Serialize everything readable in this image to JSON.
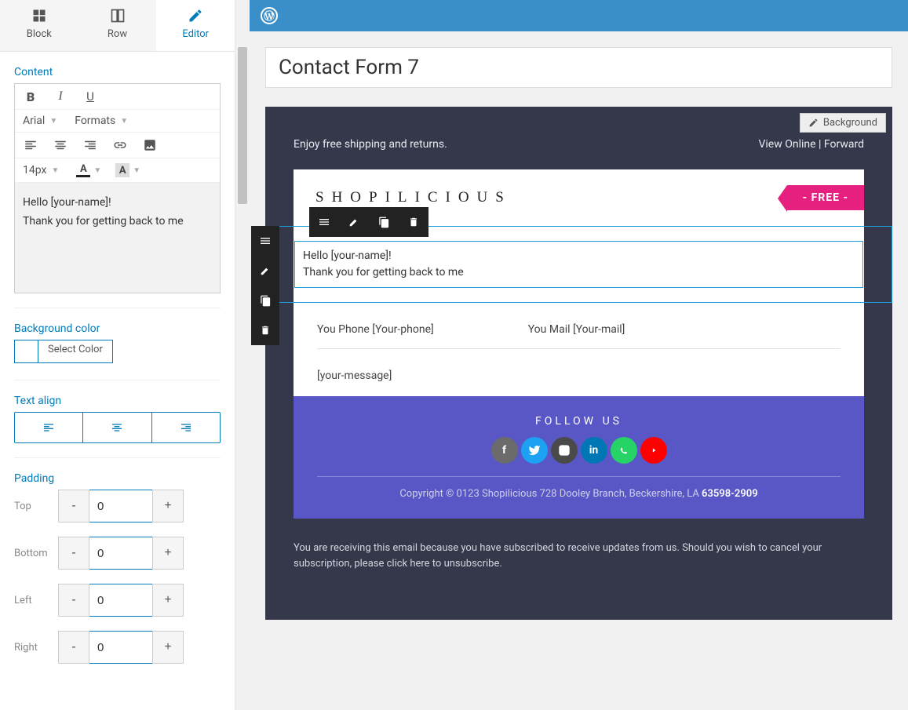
{
  "tabs": {
    "block": "Block",
    "row": "Row",
    "editor": "Editor"
  },
  "editor": {
    "content_title": "Content",
    "font": "Arial",
    "formats": "Formats",
    "fontsize": "14px",
    "line1": "Hello [your-name]!",
    "line2": "Thank you for getting back to me"
  },
  "bgcolor": {
    "title": "Background color",
    "btn": "Select Color"
  },
  "align": {
    "title": "Text align"
  },
  "padding": {
    "title": "Padding",
    "top_label": "Top",
    "top": "0",
    "bottom_label": "Bottom",
    "bottom": "0",
    "left_label": "Left",
    "left": "0",
    "right_label": "Right",
    "right": "0"
  },
  "main": {
    "title": "Contact Form 7",
    "bg_btn": "Background",
    "shipping": "Enjoy free shipping and returns.",
    "view_online": "View Online",
    "forward": "Forward",
    "brand": "SHOPILICIOUS",
    "free": "- FREE -",
    "hello": "Hello [your-name]!",
    "thanks": "Thank you for getting back to me",
    "phone": "You Phone [Your-phone]",
    "mail": "You Mail [Your-mail]",
    "message": "[your-message]",
    "follow": "FOLLOW US",
    "copyright_prefix": "Copyright © 0123 Shopilicious 728 Dooley Branch, Beckershire, LA ",
    "copyright_code": "63598-2909",
    "disclaimer": "You are receiving this email because you have subscribed to receive updates from us. Should you wish to cancel your subscription, please click here to unsubscribe."
  }
}
